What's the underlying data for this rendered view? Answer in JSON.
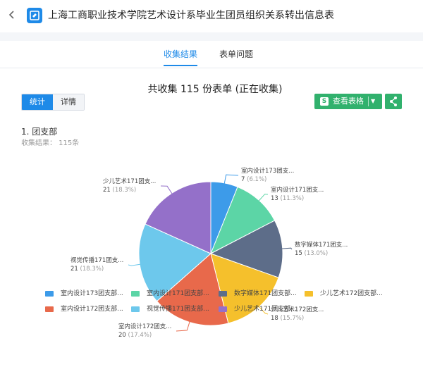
{
  "header": {
    "back_icon": "chevron-left",
    "form_icon": "form-edit-icon",
    "title": "上海工商职业技术学院艺术设计系毕业生团员组织关系转出信息表"
  },
  "tabs": [
    {
      "label": "收集结果",
      "active": true
    },
    {
      "label": "表单问题",
      "active": false
    }
  ],
  "toolbar": {
    "summary": "共收集 115 份表单 (正在收集)",
    "seg": [
      {
        "label": "统计",
        "active": true
      },
      {
        "label": "详情",
        "active": false
      }
    ],
    "view_sheet_label": "查看表格",
    "accent_green": "#31b16d",
    "accent_blue": "#1e8ae8"
  },
  "question": {
    "title": "1.  团支部",
    "result": "收集结果：  115条"
  },
  "chart_data": {
    "type": "pie",
    "title": "",
    "total": 115,
    "slices": [
      {
        "name": "室内设计173团支部",
        "label": "室内设计173团支...",
        "legend": "室内设计173团支部...",
        "value": 7,
        "percent": "6.1%",
        "color": "#3d9be9"
      },
      {
        "name": "室内设计171团支部",
        "label": "室内设计171团支...",
        "legend": "室内设计171团支部...",
        "value": 13,
        "percent": "11.3%",
        "color": "#5cd5a6"
      },
      {
        "name": "数字媒体171团支部",
        "label": "数字媒体171团支...",
        "legend": "数字媒体171团支部...",
        "value": 15,
        "percent": "13.0%",
        "color": "#5d6d89"
      },
      {
        "name": "少儿艺术172团支部",
        "label": "少儿艺术172团支...",
        "legend": "少儿艺术172团支部...",
        "value": 18,
        "percent": "15.7%",
        "color": "#f5c02c"
      },
      {
        "name": "室内设计172团支部",
        "label": "室内设计172团支...",
        "legend": "室内设计172团支部...",
        "value": 20,
        "percent": "17.4%",
        "color": "#e8694b"
      },
      {
        "name": "视觉传播171团支部",
        "label": "视觉传播171团支...",
        "legend": "视觉传播171团支部...",
        "value": 21,
        "percent": "18.3%",
        "color": "#6dc8ec"
      },
      {
        "name": "少儿艺术171团支部",
        "label": "少儿艺术171团支...",
        "legend": "少儿艺术171团支部...",
        "value": 21,
        "percent": "18.3%",
        "color": "#9470c9"
      }
    ],
    "start_angle_deg": 0,
    "direction": "clockwise",
    "legend_position": "bottom"
  }
}
